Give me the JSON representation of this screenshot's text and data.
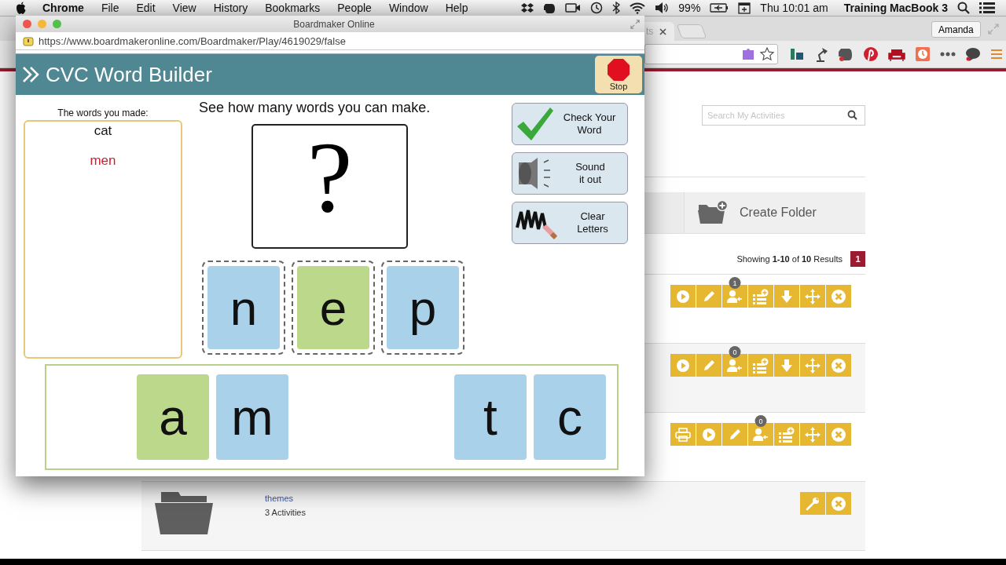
{
  "menu_bar": {
    "app": "Chrome",
    "menus": [
      "File",
      "Edit",
      "View",
      "History",
      "Bookmarks",
      "People",
      "Window",
      "Help"
    ],
    "battery": "99%",
    "clock": "Thu 10:01 am",
    "user": "Training MacBook 3"
  },
  "browser": {
    "tab_fragment": "ts",
    "profile": "Amanda"
  },
  "page": {
    "search": {
      "placeholder": "Search My Activities"
    },
    "create_folder": "Create Folder",
    "results": "Showing **1-10** of **10** Results",
    "pager": [
      {
        "label": "1",
        "selected": true
      }
    ],
    "rows": [
      {
        "actions": [
          {
            "kind": "play"
          },
          {
            "kind": "edit"
          },
          {
            "kind": "assign",
            "badge": "1"
          },
          {
            "kind": "add-list"
          },
          {
            "kind": "download"
          },
          {
            "kind": "move"
          },
          {
            "kind": "delete"
          }
        ]
      },
      {
        "actions": [
          {
            "kind": "play"
          },
          {
            "kind": "edit"
          },
          {
            "kind": "assign",
            "badge": "0"
          },
          {
            "kind": "add-list"
          },
          {
            "kind": "download"
          },
          {
            "kind": "move"
          },
          {
            "kind": "delete"
          }
        ]
      },
      {
        "actions": [
          {
            "kind": "print"
          },
          {
            "kind": "play"
          },
          {
            "kind": "edit"
          },
          {
            "kind": "assign",
            "badge": "0"
          },
          {
            "kind": "add-list"
          },
          {
            "kind": "move"
          },
          {
            "kind": "delete"
          }
        ]
      },
      {
        "folder": {
          "name": "themes",
          "count": "3 Activities"
        },
        "actions": [
          {
            "kind": "settings"
          },
          {
            "kind": "delete"
          }
        ]
      }
    ]
  },
  "popup": {
    "title": "Boardmaker Online",
    "url": "https://www.boardmakeronline.com/Boardmaker/Play/4619029/false",
    "activity_title": "CVC Word Builder",
    "stop": "Stop",
    "words_label": "The words you made:",
    "words": [
      {
        "text": "cat",
        "color": "#111111"
      },
      {
        "text": "men",
        "color": "#cc1f2e"
      }
    ],
    "prompt": "See how many words you can make.",
    "answer": "?",
    "slots": [
      {
        "letter": "n",
        "color": "#a9d2ea"
      },
      {
        "letter": "e",
        "color": "#bcd98b"
      },
      {
        "letter": "p",
        "color": "#a9d2ea"
      }
    ],
    "tray": [
      {
        "kind": "empty"
      },
      {
        "kind": "tile",
        "letter": "a",
        "color": "#bcd98b"
      },
      {
        "kind": "tile",
        "letter": "m",
        "color": "#a9d2ea"
      },
      {
        "kind": "empty"
      },
      {
        "kind": "empty"
      },
      {
        "kind": "tile",
        "letter": "t",
        "color": "#a9d2ea"
      },
      {
        "kind": "tile",
        "letter": "c",
        "color": "#a9d2ea"
      }
    ],
    "buttons": [
      {
        "kind": "check",
        "label": "Check Your\nWord"
      },
      {
        "kind": "sound",
        "label": "Sound\nit out"
      },
      {
        "kind": "clear",
        "label": "Clear\nLetters"
      }
    ]
  }
}
